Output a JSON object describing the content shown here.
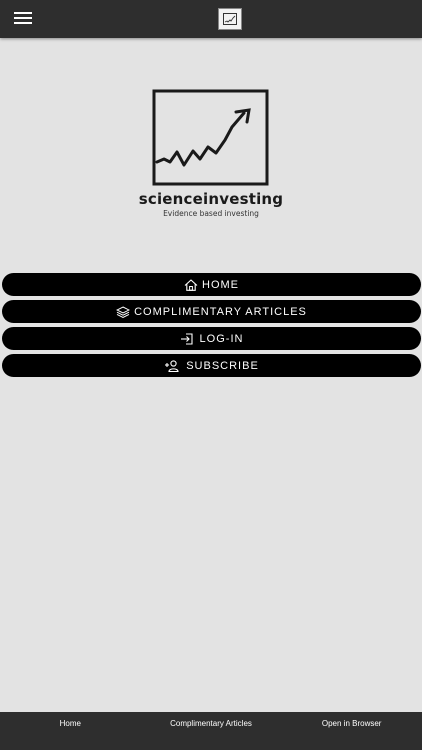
{
  "topbar": {
    "menu_icon": "hamburger-menu-icon",
    "app_icon": "chart-logo-icon"
  },
  "logo": {
    "name": "scienceinvesting",
    "tagline": "Evidence based investing"
  },
  "nav": [
    {
      "label": "HOME",
      "icon": "home-icon"
    },
    {
      "label": "COMPLIMENTARY ARTICLES",
      "icon": "layers-icon"
    },
    {
      "label": "LOG-IN",
      "icon": "login-icon"
    },
    {
      "label": "SUBSCRIBE",
      "icon": "add-user-icon"
    }
  ],
  "bottom_tabs": [
    {
      "label": "Home"
    },
    {
      "label": "Complimentary Articles"
    },
    {
      "label": "Open in Browser"
    }
  ],
  "colors": {
    "background": "#e3e3e3",
    "bar": "#2e2e2e",
    "button": "#000000",
    "text_light": "#ffffff"
  }
}
